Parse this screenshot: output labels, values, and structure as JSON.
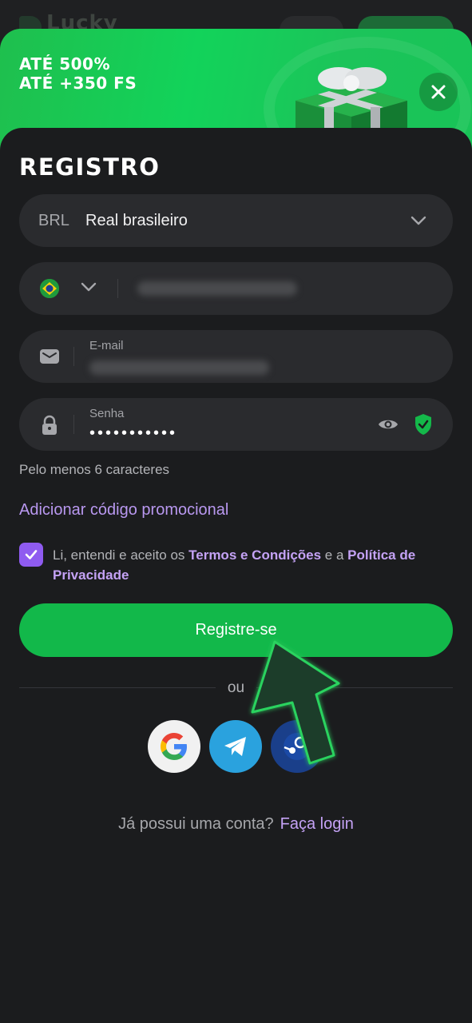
{
  "banner": {
    "line1": "ATÉ 500%",
    "line2": "ATÉ +350 FS"
  },
  "form": {
    "title": "REGISTRO",
    "currency": {
      "code": "BRL",
      "name": "Real brasileiro"
    },
    "email": {
      "label": "E-mail"
    },
    "password": {
      "label": "Senha",
      "value": "•••••••••••"
    },
    "hint": "Pelo menos 6 caracteres",
    "promo_link": "Adicionar código promocional",
    "terms": {
      "prefix": "Li, entendi e aceito os ",
      "terms_link": "Termos e Condições",
      "middle": " e a ",
      "privacy_link": "Política de Privacidade",
      "checked": true
    },
    "register_button": "Registre-se",
    "or_text": "ou",
    "login_prompt": "Já possui uma conta?",
    "login_link": "Faça login"
  },
  "colors": {
    "accent_green": "#12b84a",
    "link_purple": "#c4a2f5",
    "checkbox_purple": "#8f5bf0",
    "background": "#1b1c1e",
    "field_bg": "#2a2b2e"
  },
  "icons": {
    "close": "close-icon",
    "dropdown": "chevron-down-icon",
    "flag": "brazil-flag-icon",
    "email": "envelope-icon",
    "password": "lock-icon",
    "show_password": "eye-icon",
    "secure": "shield-check-icon",
    "social": [
      "google-icon",
      "telegram-icon",
      "steam-icon"
    ]
  }
}
